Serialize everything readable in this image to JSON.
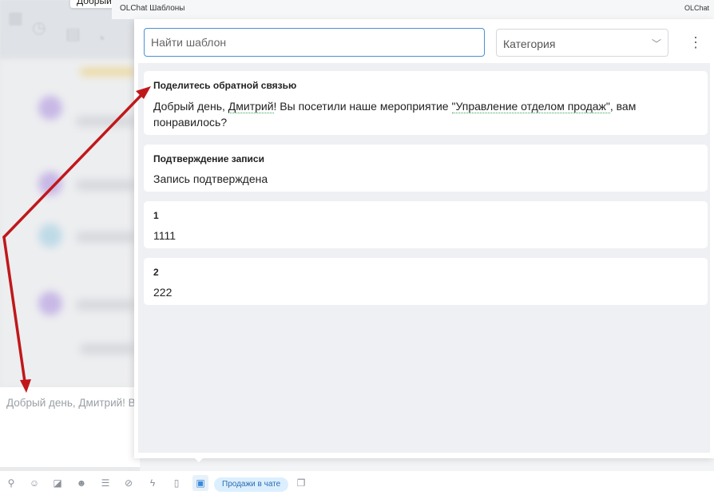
{
  "background": {
    "tooltip_text": "Добрый д",
    "composer_text": "Добрый день, Дмитрий! В"
  },
  "header": {
    "left_title": "OLChat Шаблоны",
    "right_title": "OLChat"
  },
  "search": {
    "placeholder": "Найти шаблон"
  },
  "category": {
    "label": "Категория"
  },
  "templates": [
    {
      "title": "Поделитесь обратной связью",
      "text_parts": [
        "Добрый день, ",
        "Дмитрий",
        "! Вы посетили наше мероприятие ",
        "\"Управление отделом продаж\"",
        ", вам понравилось?"
      ]
    },
    {
      "title": "Подтверждение записи",
      "text": "Запись подтверждена"
    },
    {
      "title": "1",
      "text": "1111"
    },
    {
      "title": "2",
      "text": "222"
    }
  ],
  "toolbar": {
    "icons": [
      "paperclip-icon",
      "person-icon",
      "slash-icon",
      "smile-icon",
      "stack-icon",
      "eye-off-icon",
      "lightning-icon",
      "document-icon",
      "template-icon",
      "chat-window-icon"
    ],
    "sales_pill": "Продажи в чате"
  },
  "colors": {
    "accent": "#4a90d9",
    "arrow": "#c0181a",
    "link_underline": "#37a155"
  }
}
